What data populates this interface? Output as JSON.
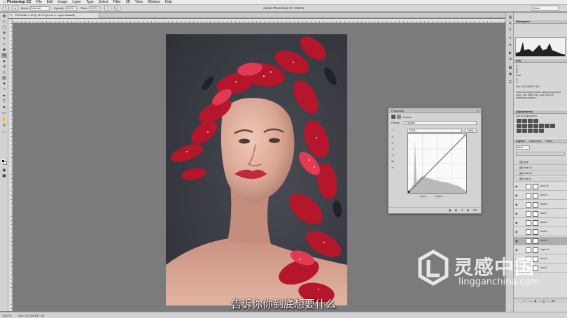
{
  "menubar": {
    "items": [
      "Photoshop CC",
      "File",
      "Edit",
      "Image",
      "Layer",
      "Type",
      "Select",
      "Filter",
      "3D",
      "View",
      "Window",
      "Help"
    ]
  },
  "options_bar": {
    "window_title": "Adobe Photoshop CC 2015.5",
    "mode_label": "Mode:",
    "mode_value": "Normal",
    "opacity_label": "Opacity:",
    "opacity_value": "100%",
    "flow_label": "Flow:",
    "flow_value": "100%",
    "workspace_value": "Beer"
  },
  "document": {
    "tab_label": "DSC5461-1.tif @ 16.7% (Look 4, Layer Mask/8)"
  },
  "status_bar": {
    "zoom": "16.67%",
    "doc_info": "Doc: 120.0M/637.1M"
  },
  "right_panels": {
    "histogram_tab": "Histogram",
    "info_tab": "Info",
    "info_lines": [
      "R:",
      "G:",
      "B:",
      "8-bit",
      "X:",
      "Y:",
      "Doc: 120.0M/637.1M"
    ],
    "info_hint": "Click and drag to paint using foreground color. Use Shift, Opt, and Cmd for additional options.",
    "adjustments_tab": "Adjustments",
    "adjustments_label": "Add an adjustment",
    "layers_tabs": [
      "Layers",
      "Channels",
      "Paths"
    ],
    "layer_filter": "Kind",
    "layers": [
      {
        "type": "group",
        "name": "type"
      },
      {
        "type": "group",
        "name": "look 13"
      },
      {
        "type": "group",
        "name": "look 12"
      },
      {
        "type": "group",
        "name": "look 11"
      },
      {
        "type": "layer",
        "name": "look 10"
      },
      {
        "type": "layer",
        "name": "look 9"
      },
      {
        "type": "layer",
        "name": "look 8"
      },
      {
        "type": "layer",
        "name": "look 7"
      },
      {
        "type": "layer",
        "name": "look 6"
      },
      {
        "type": "layer",
        "name": "look 5"
      },
      {
        "type": "layer",
        "name": "look 4",
        "selected": true
      },
      {
        "type": "layer",
        "name": "Layer 3"
      },
      {
        "type": "layer",
        "name": "look 2"
      },
      {
        "type": "layer",
        "name": "look 1"
      }
    ]
  },
  "properties": {
    "title": "Properties",
    "subtitle": "Curves",
    "preset_label": "Preset:",
    "preset_value": "Custom",
    "channel_value": "RGB",
    "auto_label": "Auto",
    "input_label": "Input:",
    "output_label": "Output:"
  },
  "overlay": {
    "subtitle": "告诉你你到底想要什么",
    "watermark_cn": "灵感中国",
    "watermark_en": "lingganchina.com"
  },
  "colors": {
    "accent_selection": "#adadad",
    "panel_bg": "#d6d6d6",
    "canvas_bg": "#7b7b7b"
  }
}
